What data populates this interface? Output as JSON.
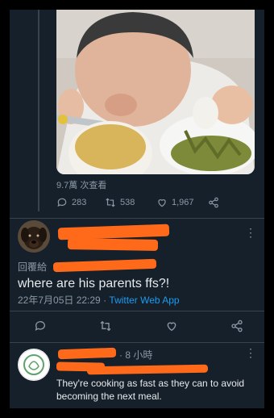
{
  "original_tweet": {
    "views": "9.7萬 次查看",
    "reply_count": "283",
    "retweet_count": "538",
    "like_count": "1,967"
  },
  "main_tweet": {
    "replying_to": "回覆給",
    "text": "where are his parents ffs?!",
    "timestamp": "22年7月05日 22:29",
    "separator": "·",
    "source": "Twitter Web App"
  },
  "reply_tweet": {
    "time_ago": "· 8 小時",
    "text": "They're cooking as fast as they can to avoid becoming the next meal."
  },
  "colors": {
    "background": "#15202b",
    "border": "#38444d",
    "muted_text": "#8b98a5",
    "link": "#1d9bf0",
    "redaction": "#ff6a1a"
  }
}
